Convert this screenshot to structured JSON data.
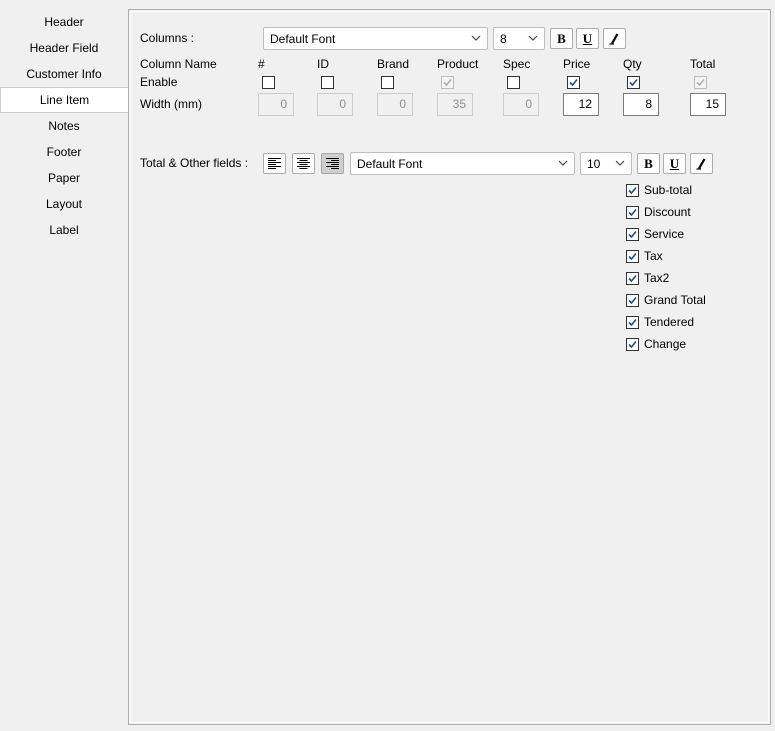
{
  "sidebar": {
    "items": [
      {
        "label": "Header",
        "active": false
      },
      {
        "label": "Header Field",
        "active": false
      },
      {
        "label": "Customer Info",
        "active": false
      },
      {
        "label": "Line Item",
        "active": true
      },
      {
        "label": "Notes",
        "active": false
      },
      {
        "label": "Footer",
        "active": false
      },
      {
        "label": "Paper",
        "active": false
      },
      {
        "label": "Layout",
        "active": false
      },
      {
        "label": "Label",
        "active": false
      }
    ]
  },
  "columns": {
    "label": "Columns :",
    "font": "Default Font",
    "size": "8",
    "bold": "B",
    "underline": "U",
    "italic": "I"
  },
  "table": {
    "column_name_label": "Column Name",
    "enable_label": "Enable",
    "width_label": "Width (mm)",
    "cols": [
      {
        "name": "#",
        "enabled": false,
        "disabled": false,
        "width": "0",
        "width_disabled": true
      },
      {
        "name": "ID",
        "enabled": false,
        "disabled": false,
        "width": "0",
        "width_disabled": true
      },
      {
        "name": "Brand",
        "enabled": false,
        "disabled": false,
        "width": "0",
        "width_disabled": true
      },
      {
        "name": "Product",
        "enabled": true,
        "disabled": true,
        "width": "35",
        "width_disabled": true
      },
      {
        "name": "Spec",
        "enabled": false,
        "disabled": false,
        "width": "0",
        "width_disabled": true
      },
      {
        "name": "Price",
        "enabled": true,
        "disabled": false,
        "width": "12",
        "width_disabled": false
      },
      {
        "name": "Qty",
        "enabled": true,
        "disabled": false,
        "width": "8",
        "width_disabled": false
      },
      {
        "name": "Total",
        "enabled": true,
        "disabled": true,
        "width": "15",
        "width_disabled": false
      }
    ]
  },
  "totals": {
    "label": "Total & Other fields :",
    "alignment": "right",
    "font": "Default Font",
    "size": "10",
    "bold": "B",
    "underline": "U",
    "italic": "I",
    "fields": [
      {
        "label": "Sub-total",
        "checked": true
      },
      {
        "label": "Discount",
        "checked": true
      },
      {
        "label": "Service",
        "checked": true
      },
      {
        "label": "Tax",
        "checked": true
      },
      {
        "label": "Tax2",
        "checked": true
      },
      {
        "label": "Grand Total",
        "checked": true
      },
      {
        "label": "Tendered",
        "checked": true
      },
      {
        "label": "Change",
        "checked": true
      }
    ]
  },
  "colors": {
    "check": "#1f4e8c",
    "accent_border": "#adadad"
  }
}
